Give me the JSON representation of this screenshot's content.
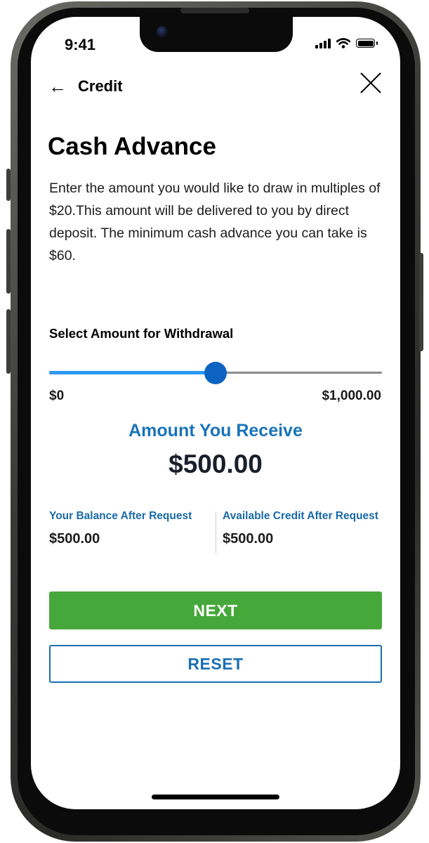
{
  "status_bar": {
    "time": "9:41",
    "icons": [
      "signal-icon",
      "wifi-icon",
      "battery-icon"
    ]
  },
  "header": {
    "back_label": "Credit",
    "back_icon": "arrow-left-icon",
    "close_icon": "close-icon"
  },
  "page": {
    "title": "Cash Advance",
    "description": "Enter the amount you would like to draw in multiples of $20.This amount will be delivered to you by direct deposit. The minimum cash advance you can take is $60."
  },
  "slider": {
    "label": "Select Amount for Withdrawal",
    "min_label": "$0",
    "max_label": "$1,000.00",
    "min": 0,
    "max": 1000,
    "value": 500
  },
  "receive": {
    "title": "Amount You Receive",
    "value": "$500.00"
  },
  "stats": {
    "balance_label": "Your Balance After Request",
    "balance_value": "$500.00",
    "credit_label": "Available Credit After Request",
    "credit_value": "$500.00"
  },
  "actions": {
    "next_label": "NEXT",
    "reset_label": "RESET"
  },
  "colors": {
    "primary_blue": "#1a74b8",
    "slider_fill": "#2b9af3",
    "slider_thumb": "#0d64c0",
    "next_green": "#46a83a"
  }
}
